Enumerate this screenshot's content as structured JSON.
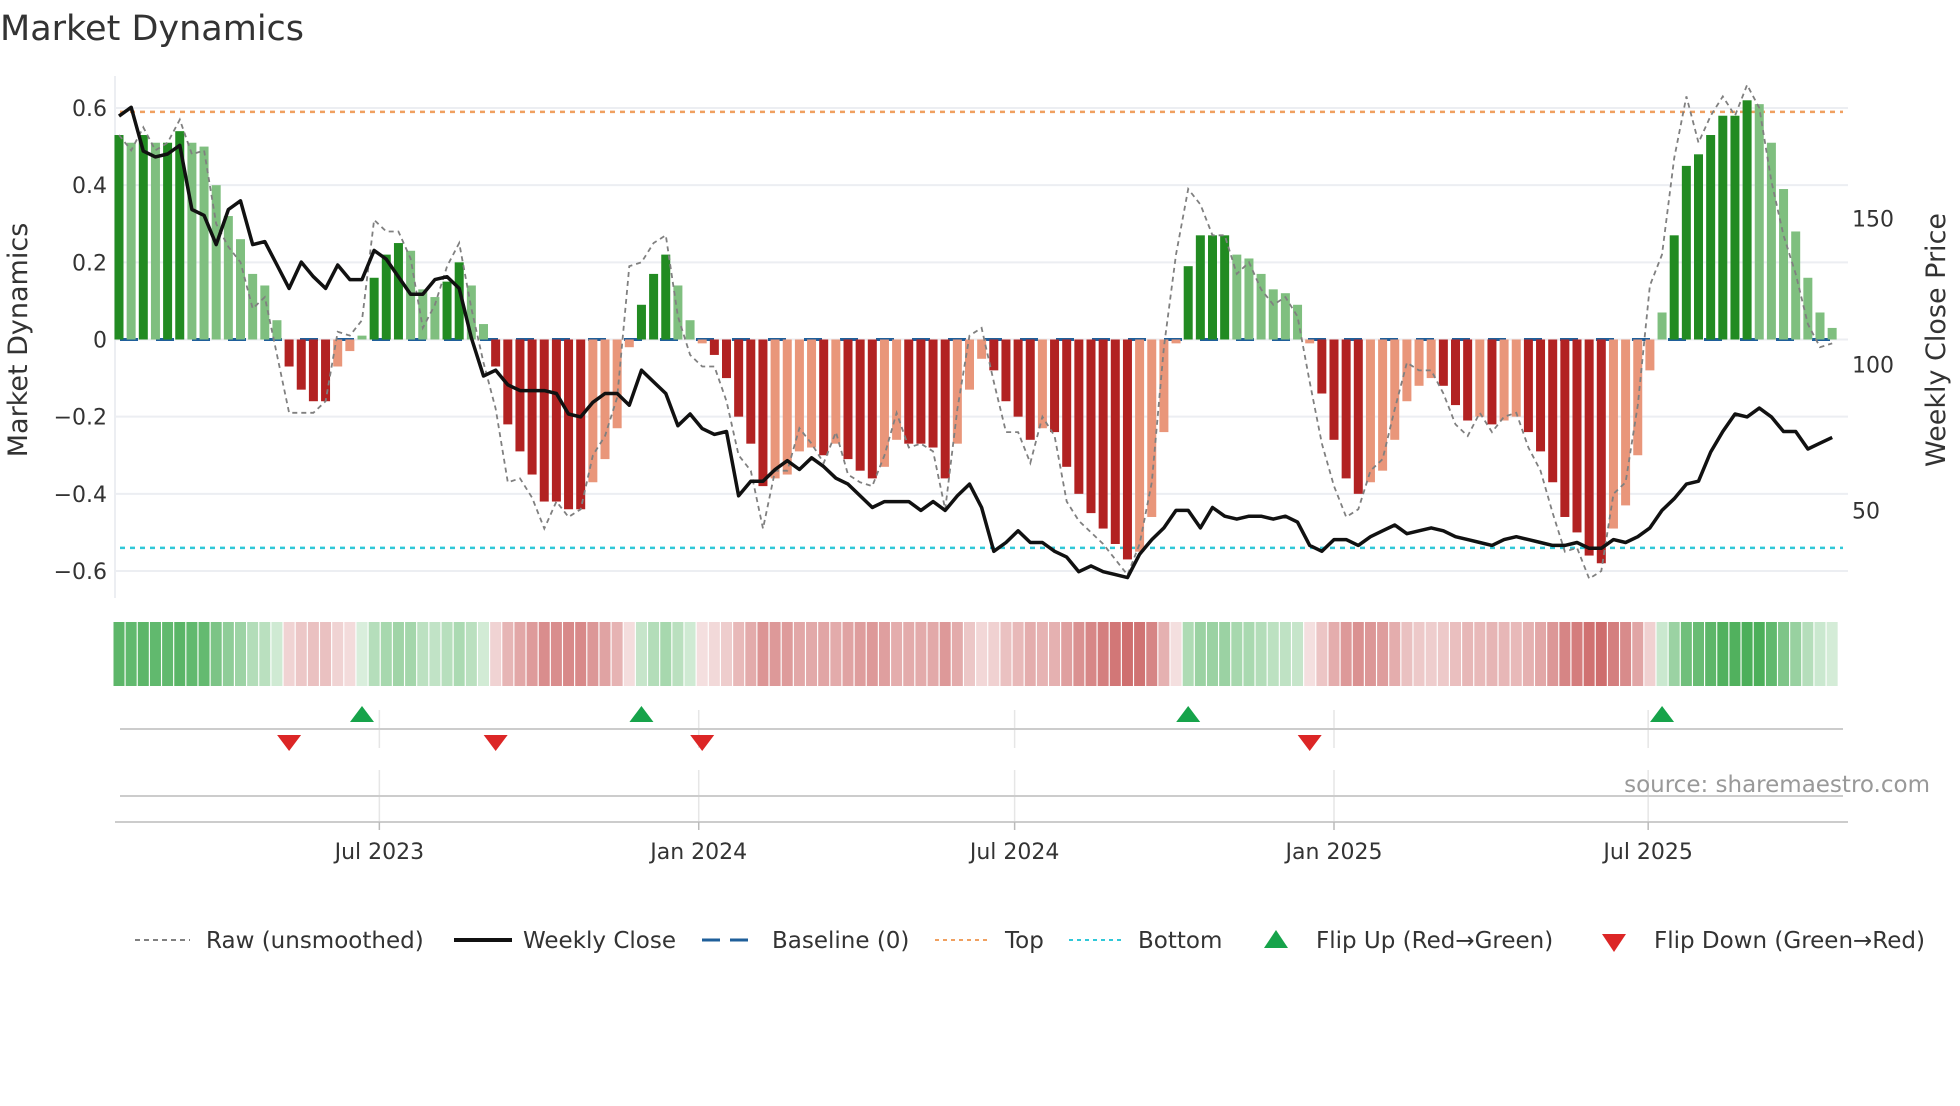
{
  "chart_data": {
    "type": "bar",
    "title": "Market Dynamics",
    "ylabel": "Market Dynamics",
    "y2label": "Weekly Close Price",
    "ylim": [
      -0.67,
      0.67
    ],
    "y2lim": [
      20,
      197
    ],
    "start_week": "2023-02-01",
    "yticks": [
      {
        "v": 0.6,
        "label": "0.6"
      },
      {
        "v": 0.4,
        "label": "0.4"
      },
      {
        "v": 0.2,
        "label": "0.2"
      },
      {
        "v": 0,
        "label": "0"
      },
      {
        "v": -0.2,
        "label": "−0.2"
      },
      {
        "v": -0.4,
        "label": "−0.4"
      },
      {
        "v": -0.6,
        "label": "−0.6"
      }
    ],
    "y2ticks": [
      {
        "v": 150,
        "label": "150"
      },
      {
        "v": 100,
        "label": "100"
      },
      {
        "v": 50,
        "label": "50"
      }
    ],
    "xticks": [
      {
        "date": "2023-07-01",
        "label": "Jul 2023"
      },
      {
        "date": "2024-01-01",
        "label": "Jan 2024"
      },
      {
        "date": "2024-07-01",
        "label": "Jul 2024"
      },
      {
        "date": "2025-01-01",
        "label": "Jan 2025"
      },
      {
        "date": "2025-07-01",
        "label": "Jul 2025"
      }
    ],
    "top_level": 0.59,
    "bottom_level": -0.54,
    "baseline": 0,
    "momentum": [
      0.53,
      0.51,
      0.53,
      0.51,
      0.51,
      0.54,
      0.51,
      0.5,
      0.4,
      0.32,
      0.26,
      0.17,
      0.14,
      0.05,
      -0.07,
      -0.13,
      -0.16,
      -0.16,
      -0.07,
      -0.03,
      0.01,
      0.16,
      0.22,
      0.25,
      0.23,
      0.13,
      0.11,
      0.15,
      0.2,
      0.14,
      0.04,
      -0.07,
      -0.22,
      -0.29,
      -0.35,
      -0.42,
      -0.42,
      -0.44,
      -0.44,
      -0.37,
      -0.31,
      -0.23,
      -0.02,
      0.09,
      0.17,
      0.22,
      0.14,
      0.05,
      -0.01,
      -0.04,
      -0.1,
      -0.2,
      -0.27,
      -0.38,
      -0.36,
      -0.35,
      -0.29,
      -0.28,
      -0.3,
      -0.27,
      -0.31,
      -0.34,
      -0.36,
      -0.33,
      -0.26,
      -0.27,
      -0.27,
      -0.28,
      -0.36,
      -0.27,
      -0.13,
      -0.05,
      -0.08,
      -0.16,
      -0.2,
      -0.26,
      -0.23,
      -0.24,
      -0.33,
      -0.4,
      -0.45,
      -0.49,
      -0.53,
      -0.57,
      -0.55,
      -0.46,
      -0.24,
      -0.01,
      0.19,
      0.27,
      0.27,
      0.27,
      0.22,
      0.21,
      0.17,
      0.13,
      0.12,
      0.09,
      -0.01,
      -0.14,
      -0.26,
      -0.36,
      -0.4,
      -0.37,
      -0.34,
      -0.26,
      -0.16,
      -0.12,
      -0.1,
      -0.12,
      -0.17,
      -0.21,
      -0.2,
      -0.22,
      -0.21,
      -0.2,
      -0.24,
      -0.29,
      -0.37,
      -0.46,
      -0.5,
      -0.56,
      -0.58,
      -0.49,
      -0.43,
      -0.3,
      -0.08,
      0.07,
      0.27,
      0.45,
      0.48,
      0.53,
      0.58,
      0.58,
      0.62,
      0.61,
      0.51,
      0.39,
      0.28,
      0.16,
      0.07,
      0.03
    ],
    "raw": [
      0.53,
      0.49,
      0.55,
      0.49,
      0.51,
      0.57,
      0.48,
      0.49,
      0.3,
      0.24,
      0.2,
      0.08,
      0.11,
      -0.04,
      -0.19,
      -0.19,
      -0.19,
      -0.16,
      0.02,
      0.01,
      0.05,
      0.31,
      0.28,
      0.28,
      0.21,
      0.03,
      0.09,
      0.19,
      0.25,
      0.08,
      -0.06,
      -0.18,
      -0.37,
      -0.36,
      -0.41,
      -0.49,
      -0.42,
      -0.46,
      -0.44,
      -0.3,
      -0.25,
      -0.15,
      0.19,
      0.2,
      0.25,
      0.27,
      0.06,
      -0.04,
      -0.07,
      -0.07,
      -0.16,
      -0.3,
      -0.34,
      -0.49,
      -0.34,
      -0.34,
      -0.23,
      -0.27,
      -0.32,
      -0.24,
      -0.35,
      -0.37,
      -0.38,
      -0.3,
      -0.19,
      -0.28,
      -0.27,
      -0.29,
      -0.44,
      -0.18,
      0.01,
      0.03,
      -0.11,
      -0.24,
      -0.24,
      -0.32,
      -0.2,
      -0.25,
      -0.42,
      -0.47,
      -0.5,
      -0.53,
      -0.57,
      -0.61,
      -0.53,
      -0.37,
      -0.02,
      0.22,
      0.39,
      0.35,
      0.27,
      0.27,
      0.17,
      0.2,
      0.13,
      0.09,
      0.11,
      0.06,
      -0.11,
      -0.27,
      -0.38,
      -0.46,
      -0.44,
      -0.34,
      -0.31,
      -0.18,
      -0.06,
      -0.08,
      -0.08,
      -0.14,
      -0.22,
      -0.25,
      -0.19,
      -0.24,
      -0.2,
      -0.19,
      -0.28,
      -0.34,
      -0.45,
      -0.55,
      -0.54,
      -0.62,
      -0.6,
      -0.4,
      -0.37,
      -0.17,
      0.14,
      0.22,
      0.47,
      0.63,
      0.51,
      0.58,
      0.63,
      0.58,
      0.66,
      0.6,
      0.41,
      0.27,
      0.17,
      0.04,
      -0.02,
      -0.01
    ],
    "close": [
      185,
      188,
      173,
      171,
      172,
      175,
      153,
      151,
      141,
      153,
      156,
      141,
      142,
      134,
      126,
      135,
      130,
      126,
      134,
      129,
      129,
      139,
      136,
      130,
      124,
      124,
      129,
      130,
      126,
      109,
      96,
      98,
      93,
      91,
      91,
      91,
      90,
      83,
      82,
      87,
      90,
      90,
      86,
      98,
      94,
      90,
      79,
      83,
      78,
      76,
      77,
      55,
      60,
      60,
      64,
      67,
      64,
      68,
      65,
      61,
      59,
      55,
      51,
      53,
      53,
      53,
      50,
      53,
      50,
      55,
      59,
      51,
      36,
      39,
      43,
      39,
      39,
      36,
      34,
      29,
      31,
      29,
      28,
      27,
      35,
      40,
      44,
      50,
      50,
      44,
      51,
      48,
      47,
      48,
      48,
      47,
      48,
      46,
      38,
      36,
      40,
      40,
      38,
      41,
      43,
      45,
      42,
      43,
      44,
      43,
      41,
      40,
      39,
      38,
      40,
      41,
      40,
      39,
      38,
      38,
      39,
      37,
      37,
      40,
      39,
      41,
      44,
      50,
      54,
      59,
      60,
      70,
      77,
      83,
      82,
      85,
      82,
      77,
      77,
      71,
      73,
      75
    ],
    "flip_up": [
      "2023-06-21",
      "2023-11-29",
      "2024-10-09",
      "2025-07-09"
    ],
    "flip_down": [
      "2023-05-10",
      "2023-09-06",
      "2024-01-03",
      "2024-12-18"
    ],
    "colors": {
      "pos_strong": "#228b22",
      "pos_weak": "#7fbf7f",
      "neg_strong": "#b22222",
      "neg_weak": "#e9967a",
      "close": "#111111",
      "raw": "#808080",
      "baseline": "#1f5f9a",
      "top": "#f0a060",
      "bottom": "#30c8d8",
      "flip_up": "#16a34a",
      "flip_down": "#dc2626"
    },
    "legend": {
      "position": "bottom",
      "items": [
        "Raw (unsmoothed)",
        "Weekly Close",
        "Baseline (0)",
        "Top",
        "Bottom",
        "Flip Up (Red→Green)",
        "Flip Down (Green→Red)"
      ]
    },
    "source": "source: sharemaestro.com"
  }
}
